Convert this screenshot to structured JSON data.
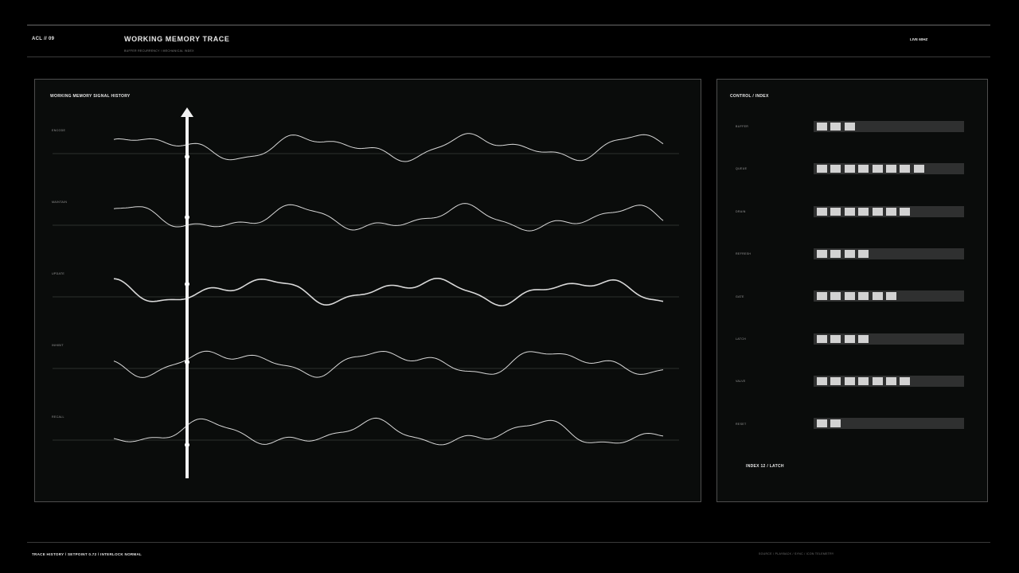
{
  "header": {
    "code": "ACL // 09",
    "title": "WORKING MEMORY TRACE",
    "subtitle": "BUFFER RECURRENCY / MECHANICAL INDEX",
    "status": "LIVE  60HZ"
  },
  "main_panel": {
    "title": "WORKING MEMORY SIGNAL HISTORY",
    "channels": [
      {
        "label": "ENCODE"
      },
      {
        "label": "MAINTAIN"
      },
      {
        "label": "UPDATE"
      },
      {
        "label": "INHIBIT"
      },
      {
        "label": "RECALL"
      }
    ]
  },
  "control_panel": {
    "title": "CONTROL / INDEX",
    "rows": [
      {
        "label": "BUFFER",
        "level": 3
      },
      {
        "label": "QUEUE",
        "level": 8
      },
      {
        "label": "DRAIN",
        "level": 7
      },
      {
        "label": "REFRESH",
        "level": 4
      },
      {
        "label": "GATE",
        "level": 6
      },
      {
        "label": "LATCH",
        "level": 4
      },
      {
        "label": "VALVE",
        "level": 7
      },
      {
        "label": "RESET",
        "level": 2
      }
    ],
    "index_label": "INDEX 12 / LATCH"
  },
  "footer": {
    "left": "TRACE HISTORY  /  SETPOINT 0.72  /  INTERLOCK NORMAL",
    "right": "SOURCE / PLAYBACK / SYNC / ICON TELEMETRY"
  }
}
